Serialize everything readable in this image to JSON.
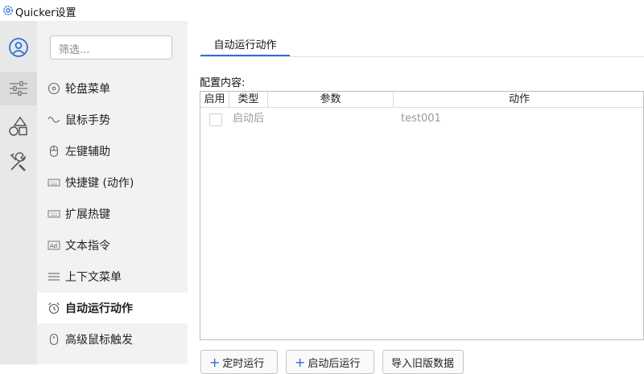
{
  "window": {
    "title": "Quicker设置"
  },
  "rail": {
    "items": [
      {
        "icon": "user-icon",
        "active": false
      },
      {
        "icon": "sliders-icon",
        "active": true
      },
      {
        "icon": "shapes-icon",
        "active": false
      },
      {
        "icon": "tools-icon",
        "active": false
      }
    ]
  },
  "sidebar": {
    "search_placeholder": "筛选...",
    "items": [
      {
        "label": "轮盘菜单",
        "icon": "wheel-icon"
      },
      {
        "label": "鼠标手势",
        "icon": "gesture-icon"
      },
      {
        "label": "左键辅助",
        "icon": "mouse-icon"
      },
      {
        "label": "快捷键 (动作)",
        "icon": "keyboard-icon"
      },
      {
        "label": "扩展热键",
        "icon": "keyboard-icon"
      },
      {
        "label": "文本指令",
        "icon": "text-ad-icon"
      },
      {
        "label": "上下文菜单",
        "icon": "menu-icon"
      },
      {
        "label": "自动运行动作",
        "icon": "alarm-icon",
        "selected": true
      },
      {
        "label": "高级鼠标触发",
        "icon": "mouse-icon"
      }
    ]
  },
  "main": {
    "tab": "自动运行动作",
    "config_label": "配置内容:",
    "grid": {
      "columns": [
        "启用",
        "类型",
        "参数",
        "动作"
      ],
      "rows": [
        {
          "enabled": false,
          "type": "启动后",
          "param": "",
          "action": "test001"
        }
      ]
    },
    "buttons": {
      "timer": "定时运行",
      "after_start": "启动后运行",
      "import": "导入旧版数据"
    }
  },
  "colors": {
    "accent": "#2a6fdb",
    "rail_bg": "#e8e8e8",
    "sidebar_bg": "#f2f2f2"
  }
}
